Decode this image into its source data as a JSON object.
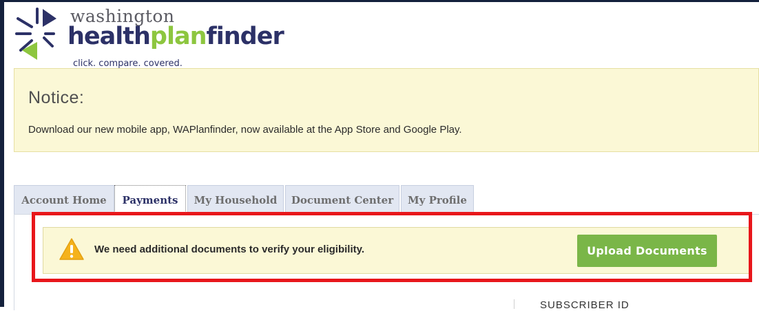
{
  "logo": {
    "line1": "washington",
    "line2_part1": "health",
    "line2_part2": "plan",
    "line2_part3": "finder",
    "tagline": "click. compare. covered."
  },
  "notice": {
    "title": "Notice:",
    "text": "Download our new mobile app, WAPlanfinder, now available at the App Store and Google Play."
  },
  "tabs": [
    {
      "label": "Account Home",
      "active": false
    },
    {
      "label": "Payments",
      "active": true
    },
    {
      "label": "My Household",
      "active": false
    },
    {
      "label": "Document Center",
      "active": false
    },
    {
      "label": "My Profile",
      "active": false
    }
  ],
  "alert": {
    "icon": "warning-triangle-icon",
    "text": "We need additional documents to verify your eligibility.",
    "button_label": "Upload Documents"
  },
  "sidebar": {
    "subscriber_label": "SUBSCRIBER ID"
  },
  "colors": {
    "brand_navy": "#2c3167",
    "brand_green": "#8dc63f",
    "notice_bg": "#fbf8d6",
    "button_green": "#7ab648",
    "highlight_red": "#e8161b",
    "warning_yellow": "#f5b21b"
  }
}
